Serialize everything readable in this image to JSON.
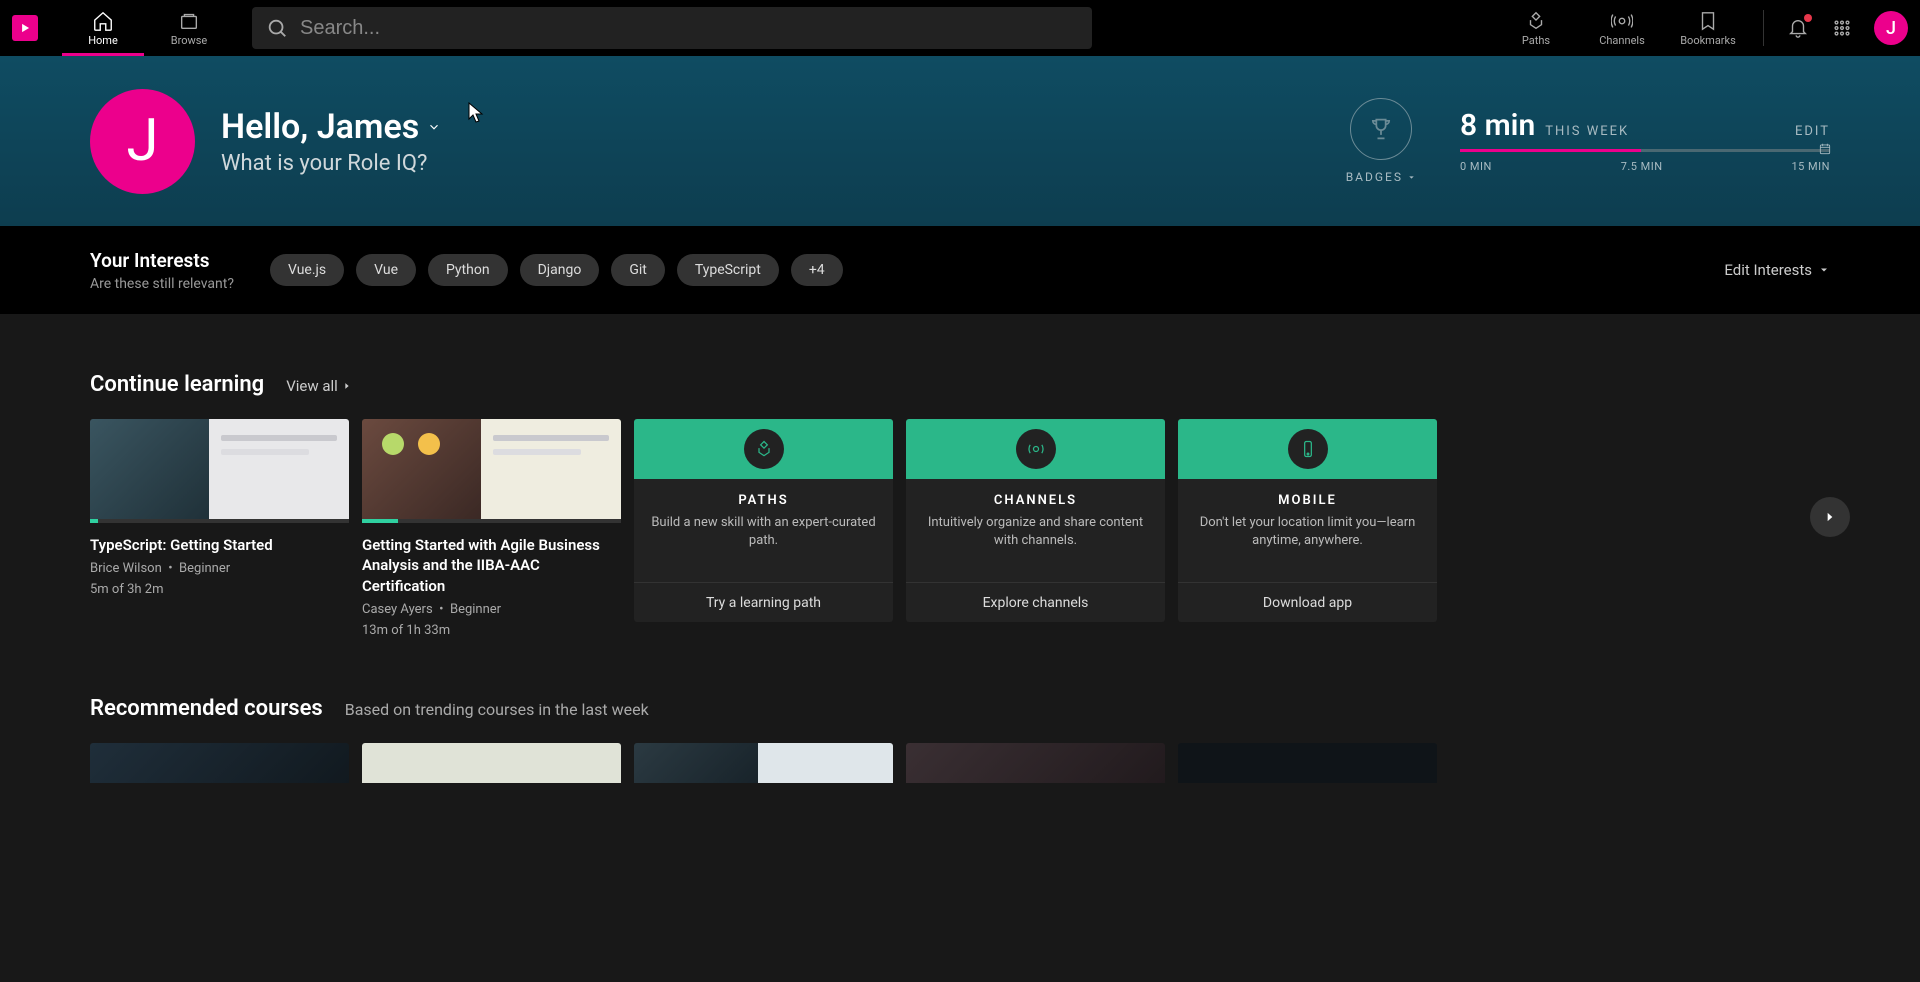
{
  "nav": {
    "home": "Home",
    "browse": "Browse",
    "paths": "Paths",
    "channels": "Channels",
    "bookmarks": "Bookmarks",
    "search_placeholder": "Search...",
    "avatar_initial": "J"
  },
  "hero": {
    "avatar_initial": "J",
    "greeting": "Hello, James",
    "sub": "What is your Role IQ?",
    "badges_label": "BADGES",
    "minutes": "8 min",
    "this_week": "THIS WEEK",
    "edit": "EDIT",
    "tick0": "0 MIN",
    "tick_mid": "7.5 MIN",
    "tick_end": "15 MIN"
  },
  "interests": {
    "title": "Your Interests",
    "sub": "Are these still relevant?",
    "chips": [
      "Vue.js",
      "Vue",
      "Python",
      "Django",
      "Git",
      "TypeScript",
      "+4"
    ],
    "edit": "Edit Interests"
  },
  "continue": {
    "title": "Continue learning",
    "view_all": "View all",
    "cards": [
      {
        "title": "TypeScript: Getting Started",
        "author": "Brice Wilson",
        "level": "Beginner",
        "duration": "5m of 3h 2m",
        "progress_pct": 3
      },
      {
        "title": "Getting Started with Agile Business Analysis and the IIBA-AAC Certification",
        "author": "Casey Ayers",
        "level": "Beginner",
        "duration": "13m of 1h 33m",
        "progress_pct": 14
      }
    ],
    "promos": [
      {
        "title": "PATHS",
        "desc": "Build a new skill with an expert-curated path.",
        "action": "Try a learning path"
      },
      {
        "title": "CHANNELS",
        "desc": "Intuitively organize and share content with channels.",
        "action": "Explore channels"
      },
      {
        "title": "MOBILE",
        "desc": "Don't let your location limit you—learn anytime, anywhere.",
        "action": "Download app"
      }
    ]
  },
  "recommended": {
    "title": "Recommended courses",
    "sub": "Based on trending courses in the last week"
  },
  "colors": {
    "accent_pink": "#ec008c",
    "accent_green": "#2BB789",
    "hero_bg_top": "#0f4c62",
    "hero_bg_bottom": "#0d3d4f"
  }
}
